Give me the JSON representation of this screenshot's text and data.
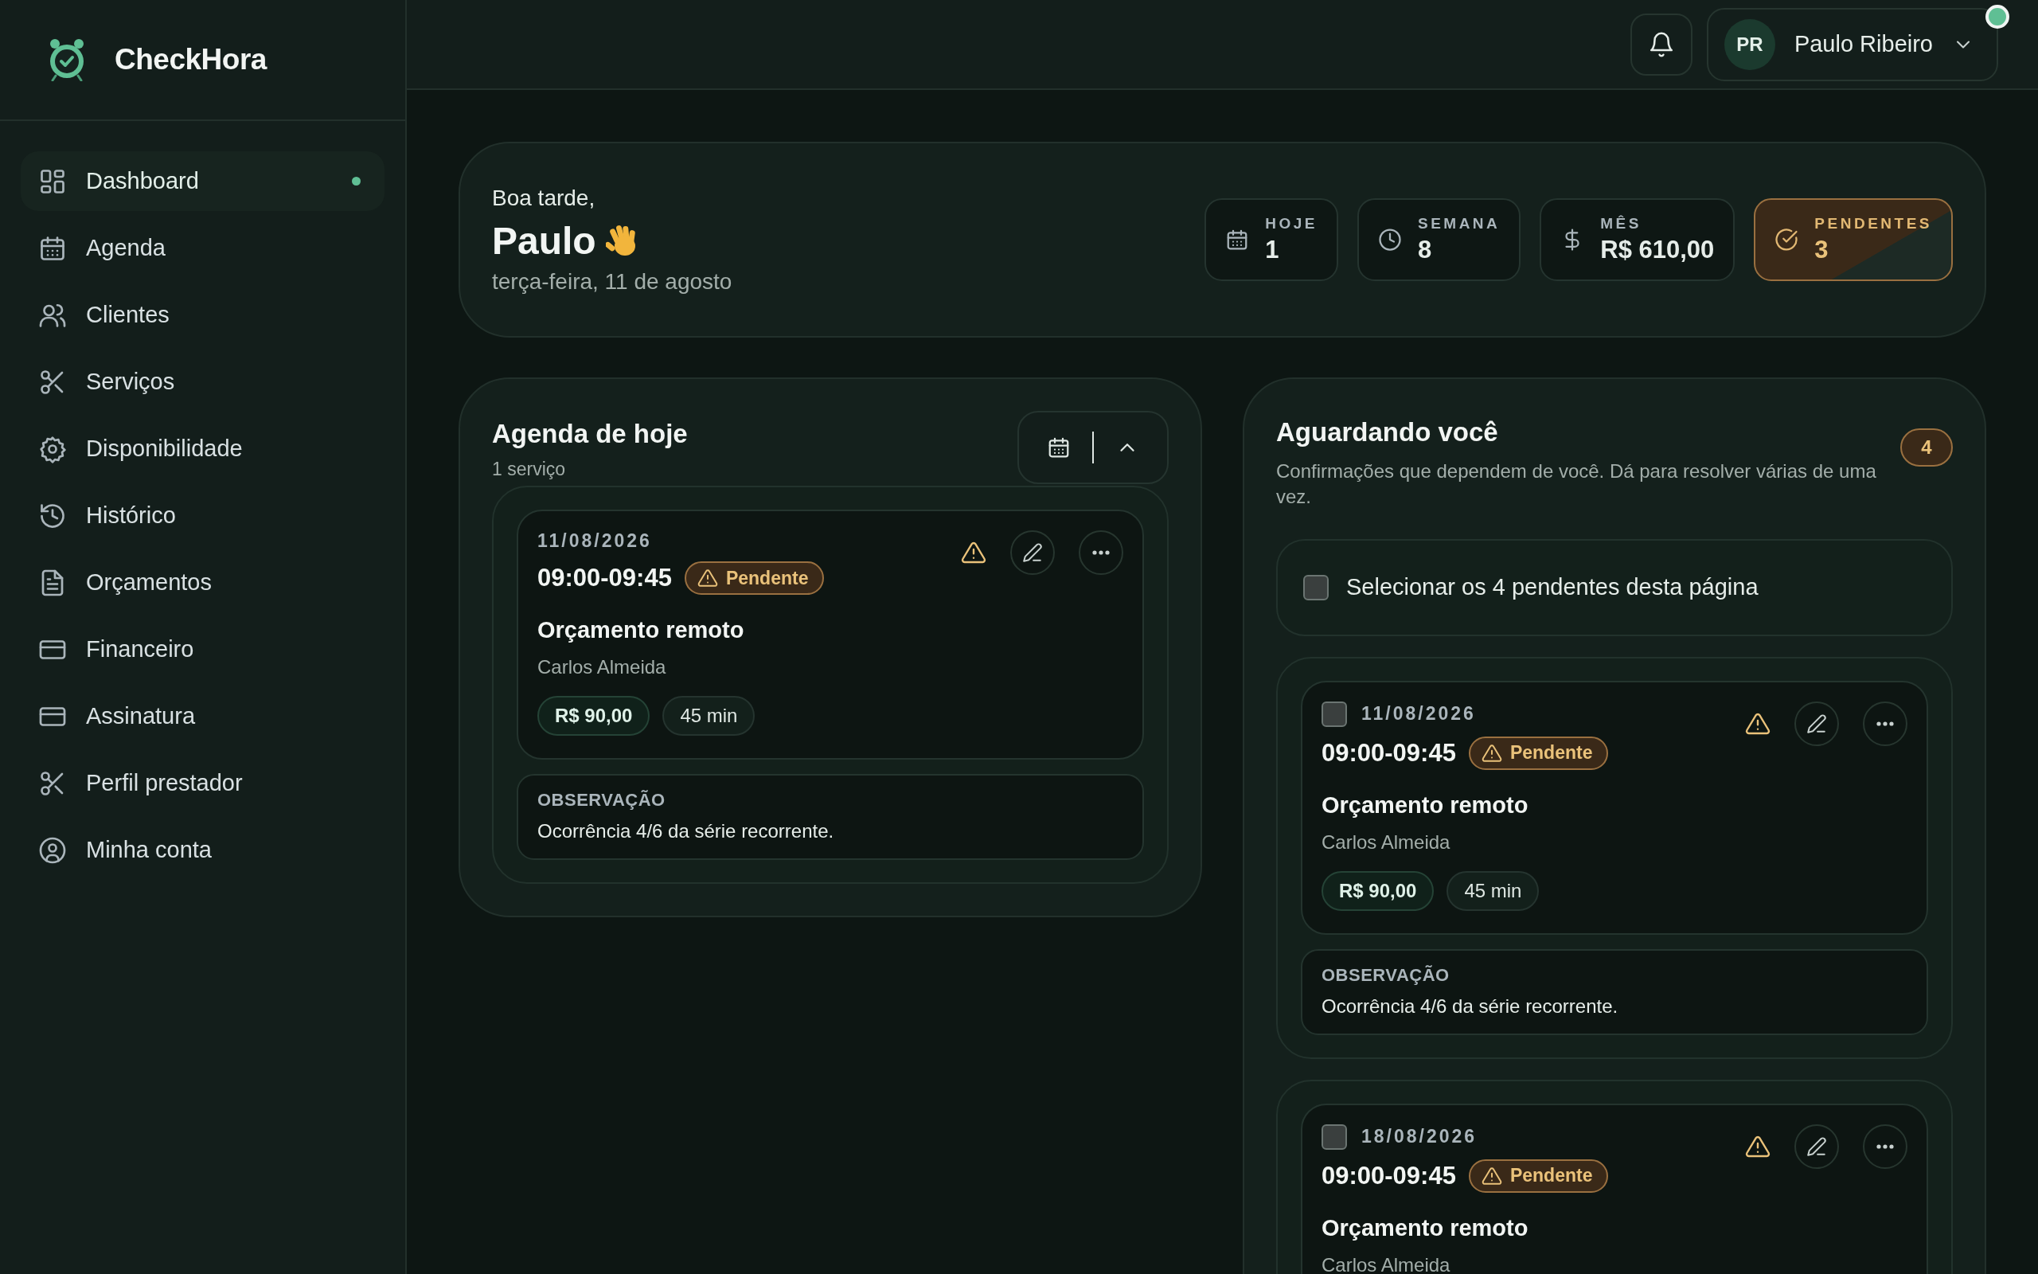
{
  "app": {
    "name": "CheckHora"
  },
  "sidebar": {
    "items": [
      {
        "label": "Dashboard",
        "selected": true
      },
      {
        "label": "Agenda",
        "selected": false
      },
      {
        "label": "Clientes",
        "selected": false
      },
      {
        "label": "Serviços",
        "selected": false
      },
      {
        "label": "Disponibilidade",
        "selected": false
      },
      {
        "label": "Histórico",
        "selected": false
      },
      {
        "label": "Orçamentos",
        "selected": false
      },
      {
        "label": "Financeiro",
        "selected": false
      },
      {
        "label": "Assinatura",
        "selected": false
      },
      {
        "label": "Perfil prestador",
        "selected": false
      },
      {
        "label": "Minha conta",
        "selected": false
      }
    ]
  },
  "topbar": {
    "user": {
      "initials": "PR",
      "name": "Paulo Ribeiro",
      "online": true
    }
  },
  "greeting": {
    "salutation": "Boa tarde,",
    "name": "Paulo",
    "date": "terça-feira, 11 de agosto"
  },
  "stats": [
    {
      "label": "HOJE",
      "value": "1",
      "highlighted": false
    },
    {
      "label": "SEMANA",
      "value": "8",
      "highlighted": false
    },
    {
      "label": "MÊS",
      "value": "R$ 610,00",
      "highlighted": false
    },
    {
      "label": "PENDENTES",
      "value": "3",
      "highlighted": true
    }
  ],
  "agenda_today": {
    "title": "Agenda de hoje",
    "subtitle": "1 serviço",
    "appointments": [
      {
        "date": "11/08/2026",
        "time": "09:00-09:45",
        "status": {
          "label": "Pendente",
          "kind": "pending"
        },
        "service": "Orçamento remoto",
        "client": "Carlos Almeida",
        "price": "R$ 90,00",
        "duration": "45 min",
        "note_label": "OBSERVAÇÃO",
        "note": "Ocorrência 4/6 da série recorrente."
      }
    ]
  },
  "awaiting": {
    "title": "Aguardando você",
    "count": "4",
    "description": "Confirmações que dependem de você. Dá para resolver várias de uma vez.",
    "select_all": {
      "label": "Selecionar os 4 pendentes desta página",
      "checked": false
    },
    "items": [
      {
        "checked": false,
        "date": "11/08/2026",
        "time": "09:00-09:45",
        "status": {
          "label": "Pendente",
          "kind": "pending"
        },
        "service": "Orçamento remoto",
        "client": "Carlos Almeida",
        "price": "R$ 90,00",
        "duration": "45 min",
        "note_label": "OBSERVAÇÃO",
        "note": "Ocorrência 4/6 da série recorrente."
      },
      {
        "checked": false,
        "date": "18/08/2026",
        "time": "09:00-09:45",
        "status": {
          "label": "Pendente",
          "kind": "pending"
        },
        "service": "Orçamento remoto",
        "client": "Carlos Almeida"
      }
    ]
  }
}
